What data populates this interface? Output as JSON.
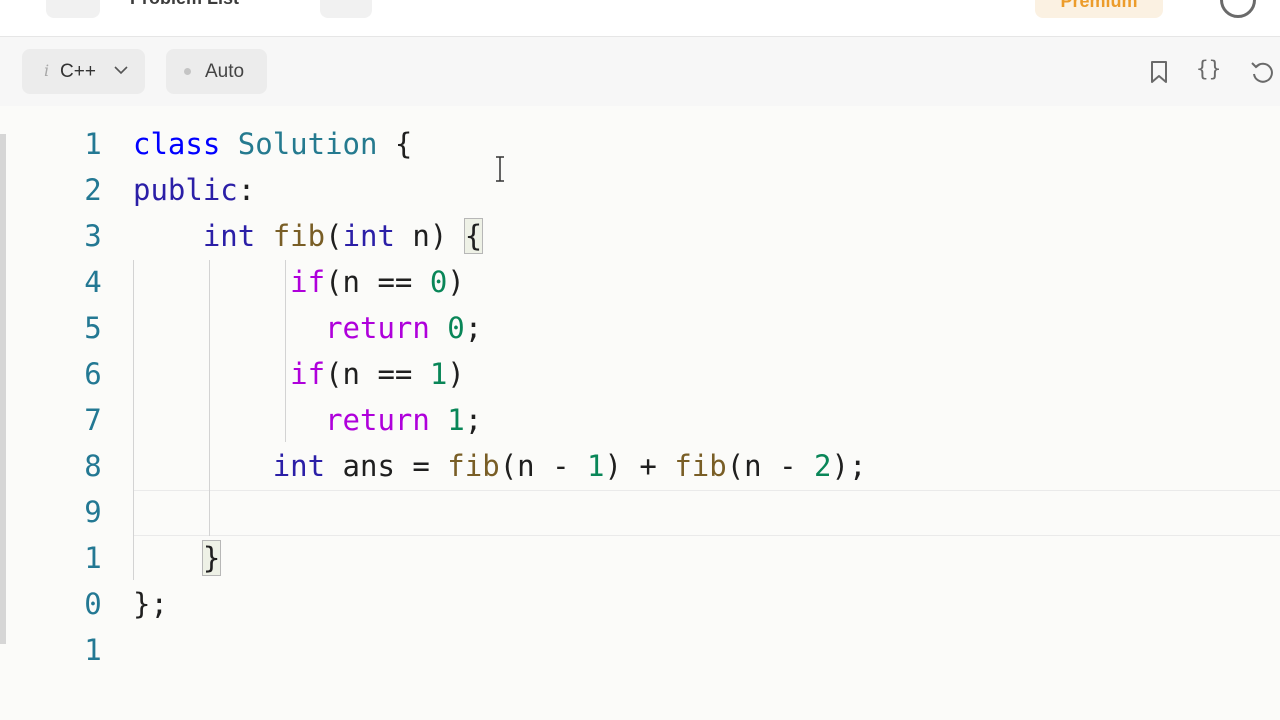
{
  "topnav": {
    "problem_list_label": "Problem List",
    "premium_label": "Premium"
  },
  "toolbar": {
    "language": "C++",
    "language_info_icon": "i",
    "mode_label": "Auto",
    "icons": [
      "bookmark-icon",
      "braces-icon",
      "reset-icon"
    ],
    "braces_glyph": "{}"
  },
  "editor": {
    "line_numbers": [
      "1",
      "2",
      "3",
      "4",
      "5",
      "6",
      "7",
      "8",
      "9",
      "1",
      "0",
      "1"
    ],
    "lines": {
      "l1": {
        "kw": "class",
        "sp": " ",
        "cls": "Solution",
        "rest": " {"
      },
      "l2": {
        "kw": "public",
        "rest": ":"
      },
      "l3": {
        "indent": "    ",
        "kw": "int",
        "sp": " ",
        "fn": "fib",
        "p1": "(",
        "kw2": "int",
        "p2": " n) ",
        "br": "{"
      },
      "l4": {
        "indent": "         ",
        "ctrl": "if",
        "p1": "(n == ",
        "num": "0",
        "p2": ")"
      },
      "l5": {
        "indent": "           ",
        "ctrl": "return",
        "sp": " ",
        "num": "0",
        "p2": ";"
      },
      "l6": {
        "indent": "         ",
        "ctrl": "if",
        "p1": "(n == ",
        "num": "1",
        "p2": ")"
      },
      "l7": {
        "indent": "           ",
        "ctrl": "return",
        "sp": " ",
        "num": "1",
        "p2": ";"
      },
      "l8": {
        "indent": "        ",
        "kw": "int",
        "a": " ans = ",
        "fn1": "fib",
        "b": "(n - ",
        "n1": "1",
        "c": ") + ",
        "fn2": "fib",
        "d": "(n - ",
        "n2": "2",
        "e": ");"
      },
      "l9": {
        "text": ""
      },
      "l10": {
        "indent": "    ",
        "br": "}"
      },
      "l11": {
        "text": "};"
      },
      "l12": {
        "text": ""
      }
    },
    "colors": {
      "keyword": "#0000ff",
      "class_name": "#257a8f",
      "function": "#795e26",
      "control": "#af00db",
      "number": "#098658",
      "line_number": "#237893"
    }
  }
}
